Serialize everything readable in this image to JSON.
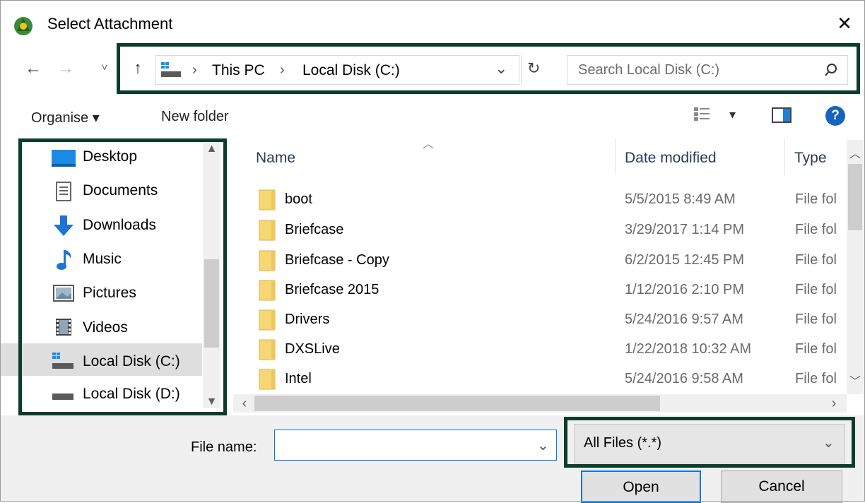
{
  "window": {
    "title": "Select Attachment",
    "close_glyph": "✕",
    "icon": "app-logo-icon"
  },
  "nav": {
    "back": "←",
    "forward": "→",
    "recent": "˅",
    "up": "↑",
    "breadcrumb": [
      "This PC",
      "Local Disk (C:)"
    ],
    "separator": "›",
    "dropdown": "⌄",
    "refresh": "↻",
    "search_placeholder": "Search Local Disk (C:)",
    "search_icon": "⌕"
  },
  "toolbar": {
    "organise": "Organise ▾",
    "new_folder": "New folder",
    "view_dd": "▾",
    "help": "?"
  },
  "sidebar": {
    "items": [
      {
        "label": "Desktop",
        "icon": "desktop-icon"
      },
      {
        "label": "Documents",
        "icon": "documents-icon"
      },
      {
        "label": "Downloads",
        "icon": "downloads-icon"
      },
      {
        "label": "Music",
        "icon": "music-icon"
      },
      {
        "label": "Pictures",
        "icon": "pictures-icon"
      },
      {
        "label": "Videos",
        "icon": "videos-icon"
      },
      {
        "label": "Local Disk (C:)",
        "icon": "drive-c-icon",
        "selected": true
      },
      {
        "label": "Local Disk (D:)",
        "icon": "drive-d-icon"
      }
    ]
  },
  "files": {
    "columns": {
      "name": "Name",
      "date": "Date modified",
      "type": "Type"
    },
    "rows": [
      {
        "name": "boot",
        "date": "5/5/2015 8:49 AM",
        "type": "File fol"
      },
      {
        "name": "Briefcase",
        "date": "3/29/2017 1:14 PM",
        "type": "File fol"
      },
      {
        "name": "Briefcase - Copy",
        "date": "6/2/2015 12:45 PM",
        "type": "File fol"
      },
      {
        "name": "Briefcase 2015",
        "date": "1/12/2016 2:10 PM",
        "type": "File fol"
      },
      {
        "name": "Drivers",
        "date": "5/24/2016 9:57 AM",
        "type": "File fol"
      },
      {
        "name": "DXSLive",
        "date": "1/22/2018 10:32 AM",
        "type": "File fol"
      },
      {
        "name": "Intel",
        "date": "5/24/2016 9:58 AM",
        "type": "File fol"
      }
    ]
  },
  "bottom": {
    "file_name_label": "File name:",
    "file_name_value": "",
    "filter": "All Files (*.*)",
    "open": "Open",
    "cancel": "Cancel"
  },
  "colors": {
    "highlight_border": "#0c3d2b",
    "folder": "#f6d776",
    "focus": "#0a78d7"
  }
}
